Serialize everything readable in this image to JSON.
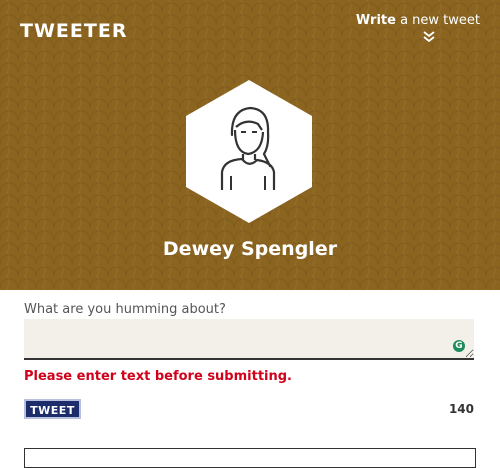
{
  "header": {
    "logo": "TWEETER",
    "write_link_strong": "Write",
    "write_link_rest": " a new tweet",
    "write_chevron_icon": "double-chevron-down-icon"
  },
  "profile": {
    "avatar_icon": "woman-avatar-icon",
    "name": "Dewey Spengler"
  },
  "composer": {
    "label": "What are you humming about?",
    "value": "",
    "grammarly_icon": "grammarly-icon",
    "error": "Please enter text before submitting.",
    "tweet_button": "TWEET",
    "char_count": "140"
  },
  "colors": {
    "hero_bg": "#8b6520",
    "error": "#d0021b",
    "button_bg": "#1d2d6b",
    "textarea_bg": "#f3f0ea"
  }
}
